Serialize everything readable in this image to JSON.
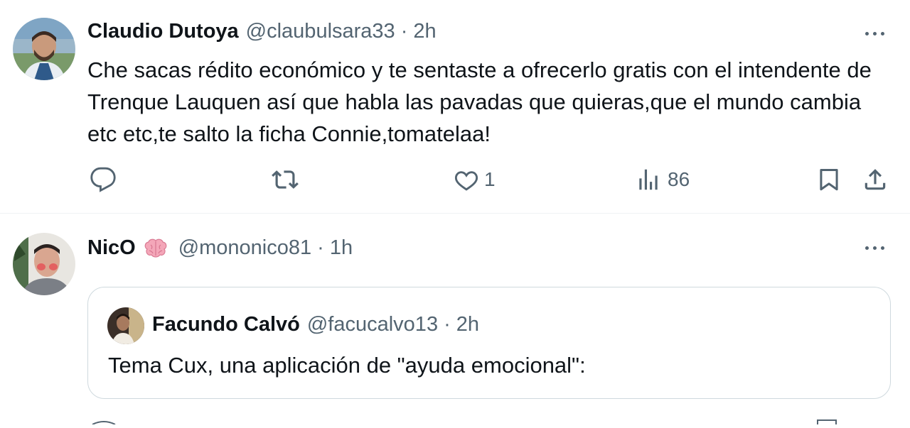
{
  "tweets": [
    {
      "name": "Claudio Dutoya",
      "handle": "@claubulsara33",
      "separator": "·",
      "time": "2h",
      "text": "Che sacas rédito económico y te sentaste a ofrecerlo gratis con el intendente de Trenque Lauquen así que habla las pavadas que quieras,que el mundo cambia etc etc,te salto la ficha Connie,tomatelaa!",
      "actions": {
        "reply_icon": "reply-icon",
        "retweet_icon": "retweet-icon",
        "like_icon": "heart-icon",
        "like_count": "1",
        "views_icon": "views-icon",
        "views_count": "86",
        "bookmark_icon": "bookmark-icon",
        "share_icon": "share-icon"
      }
    },
    {
      "name": "NicO",
      "name_emoji": "brain-emoji",
      "handle": "@mononico81",
      "separator": "·",
      "time": "1h",
      "quote": {
        "name": "Facundo Calvó",
        "handle": "@facucalvo13",
        "separator": "·",
        "time": "2h",
        "text": "Tema Cux, una aplicación de \"ayuda emocional\":"
      }
    }
  ],
  "colors": {
    "text": "#0f1419",
    "secondary": "#536471",
    "border": "#cfd9de",
    "divider": "#eff3f4",
    "brain": "#f4a7b9"
  }
}
